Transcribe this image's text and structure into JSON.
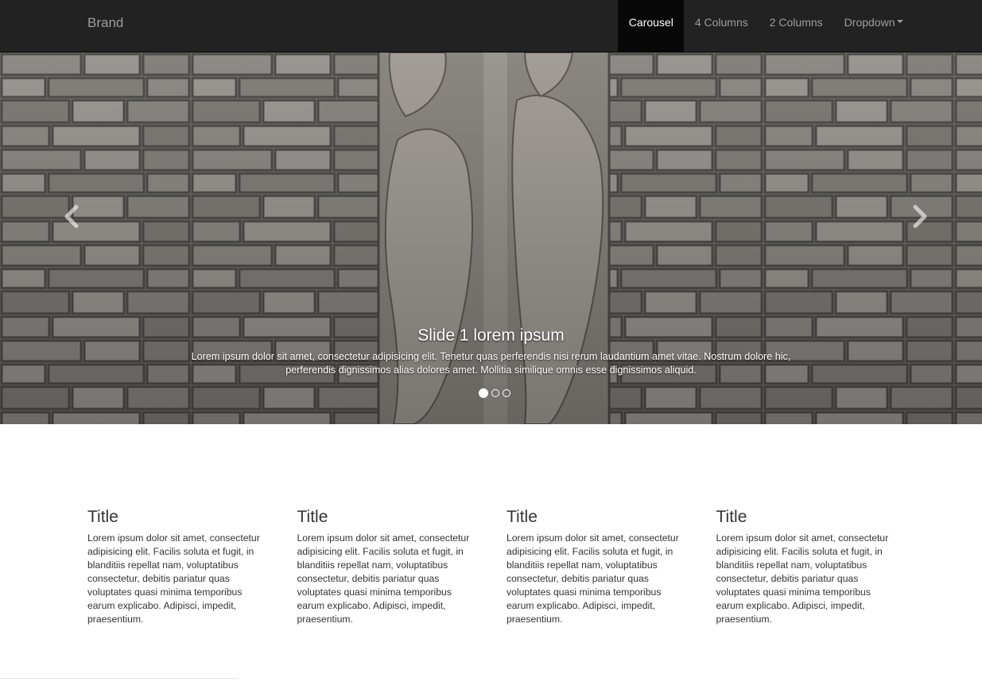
{
  "navbar": {
    "brand": "Brand",
    "items": [
      {
        "label": "Carousel",
        "active": true
      },
      {
        "label": "4 Columns",
        "active": false
      },
      {
        "label": "2 Columns",
        "active": false
      },
      {
        "label": "Dropdown",
        "active": false,
        "has_caret": true
      }
    ]
  },
  "carousel": {
    "caption_title": "Slide 1 lorem ipsum",
    "caption_text": "Lorem ipsum dolor sit amet, consectetur adipisicing elit. Tenetur quas perferendis nisi rerum laudantium amet vitae. Nostrum dolore hic, perferendis dignissimos alias dolores amet. Mollitia similique omnis esse dignissimos aliquid.",
    "slide_count": 3,
    "active_slide": 1,
    "prev_icon": "chevron-left-icon",
    "next_icon": "chevron-right-icon"
  },
  "features": [
    {
      "title": "Title",
      "text": "Lorem ipsum dolor sit amet, consectetur adipisicing elit. Facilis soluta et fugit, in blanditiis repellat nam, voluptatibus consectetur, debitis pariatur quas voluptates quasi minima temporibus earum explicabo. Adipisci, impedit, praesentium."
    },
    {
      "title": "Title",
      "text": "Lorem ipsum dolor sit amet, consectetur adipisicing elit. Facilis soluta et fugit, in blanditiis repellat nam, voluptatibus consectetur, debitis pariatur quas voluptates quasi minima temporibus earum explicabo. Adipisci, impedit, praesentium."
    },
    {
      "title": "Title",
      "text": "Lorem ipsum dolor sit amet, consectetur adipisicing elit. Facilis soluta et fugit, in blanditiis repellat nam, voluptatibus consectetur, debitis pariatur quas voluptates quasi minima temporibus earum explicabo. Adipisci, impedit, praesentium."
    },
    {
      "title": "Title",
      "text": "Lorem ipsum dolor sit amet, consectetur adipisicing elit. Facilis soluta et fugit, in blanditiis repellat nam, voluptatibus consectetur, debitis pariatur quas voluptates quasi minima temporibus earum explicabo. Adipisci, impedit, praesentium."
    }
  ],
  "colors": {
    "navbar_bg": "#222222",
    "navbar_active_bg": "#080808",
    "nav_text": "#9d9d9d",
    "stone": "#8f8c87"
  }
}
